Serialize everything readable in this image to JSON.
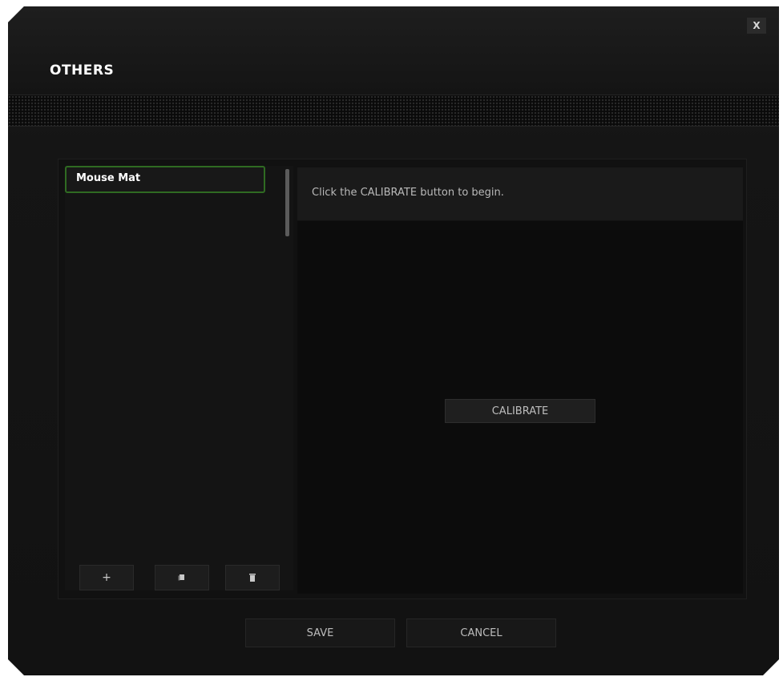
{
  "window": {
    "title": "OTHERS",
    "close_label": "X"
  },
  "list": {
    "items": [
      {
        "label": "Mouse Mat"
      }
    ],
    "buttons": [
      {
        "name": "add",
        "icon": "plus-icon",
        "label": "+"
      },
      {
        "name": "copy",
        "icon": "copy-icon"
      },
      {
        "name": "delete",
        "icon": "trash-icon"
      }
    ]
  },
  "calibration": {
    "instruction": "Click the CALIBRATE button to begin.",
    "calibrate_label": "CALIBRATE"
  },
  "footer": {
    "save_label": "SAVE",
    "cancel_label": "CANCEL"
  },
  "colors": {
    "accent": "#2f6b22",
    "background": "#121212"
  }
}
